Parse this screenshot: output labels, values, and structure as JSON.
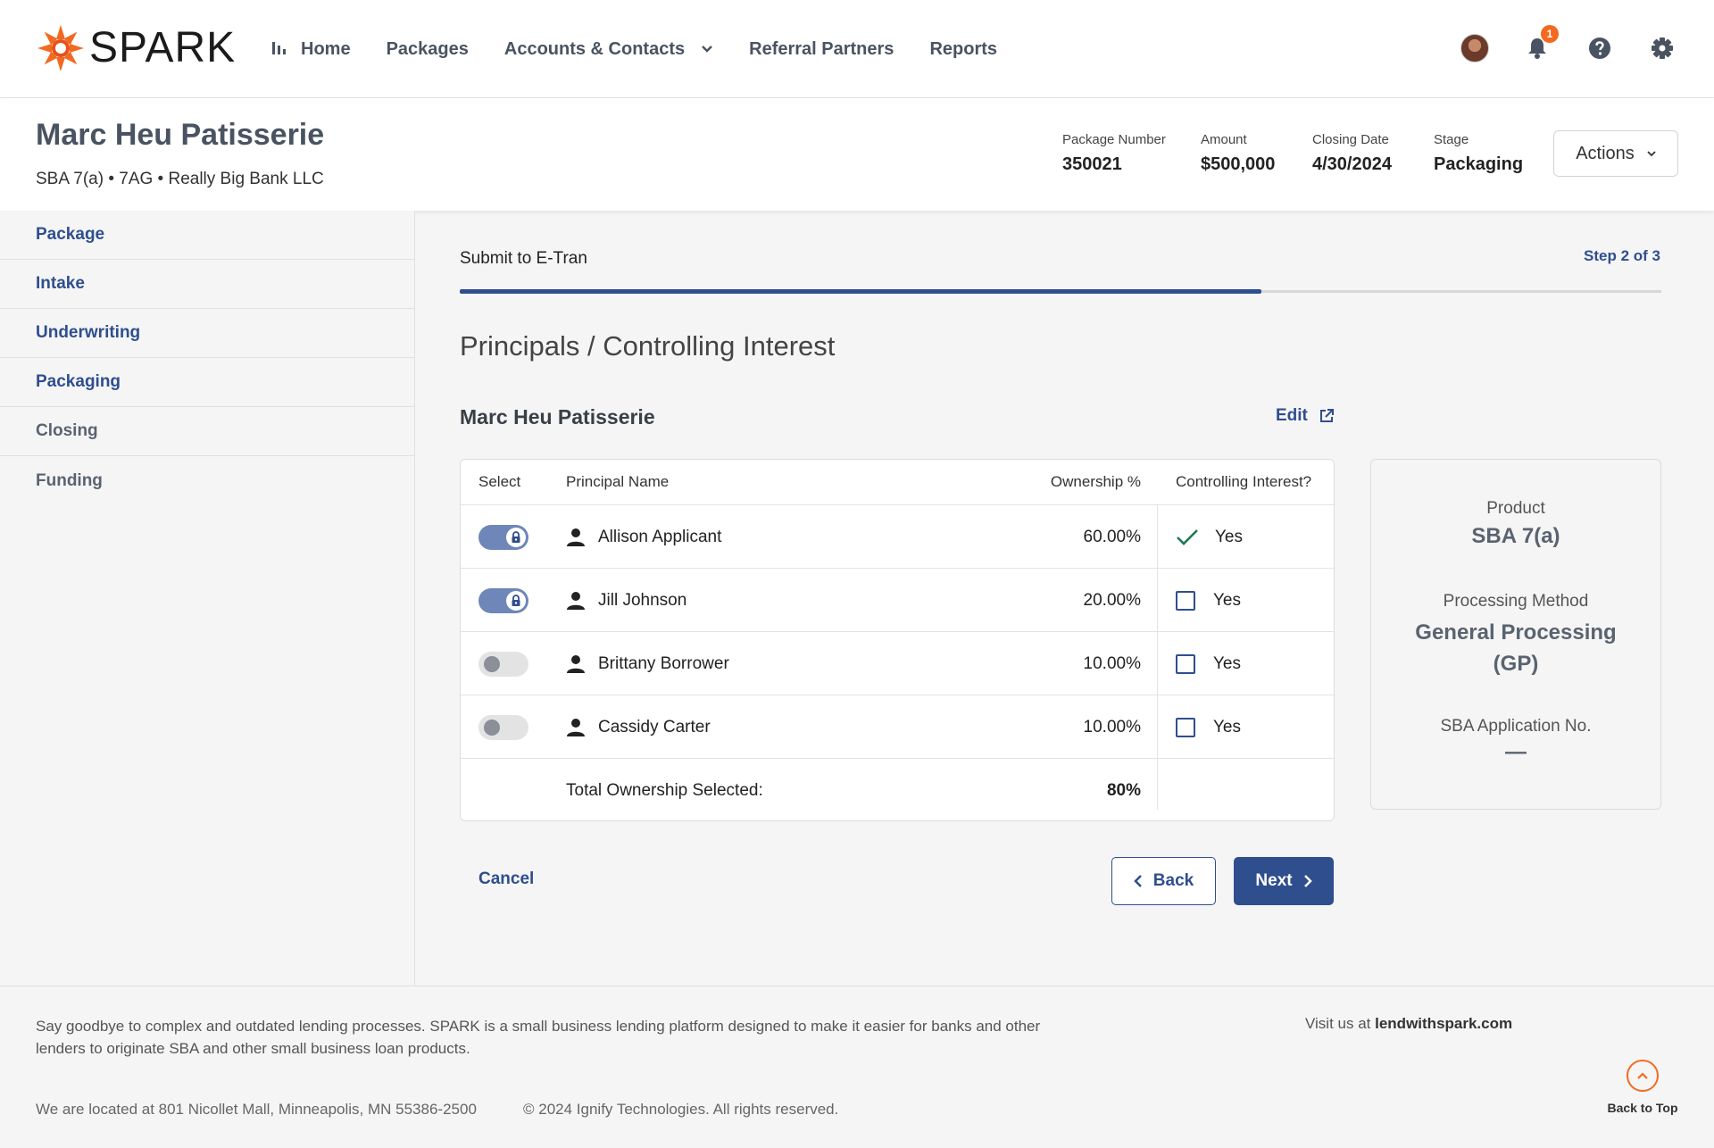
{
  "brand": {
    "name": "SPARK",
    "accent": "#f26a21",
    "primary": "#2f4e8e"
  },
  "nav": {
    "items": [
      {
        "label": "Home",
        "icon": "bar-chart-icon"
      },
      {
        "label": "Packages"
      },
      {
        "label": "Accounts & Contacts",
        "icon": "chevron-down-icon"
      },
      {
        "label": "Referral Partners"
      },
      {
        "label": "Reports"
      }
    ],
    "notifications_count": "1",
    "icons": [
      "avatar",
      "bell-icon",
      "help-icon",
      "gear-icon"
    ]
  },
  "header": {
    "title": "Marc Heu Patisserie",
    "subtitle": "SBA 7(a) • 7AG • Really Big Bank LLC",
    "meta": [
      {
        "label": "Package Number",
        "value": "350021"
      },
      {
        "label": "Amount",
        "value": "$500,000"
      },
      {
        "label": "Closing Date",
        "value": "4/30/2024"
      },
      {
        "label": "Stage",
        "value": "Packaging"
      }
    ],
    "actions_label": "Actions"
  },
  "sidebar": {
    "items": [
      {
        "label": "Package",
        "state": "active"
      },
      {
        "label": "Intake",
        "state": "active"
      },
      {
        "label": "Underwriting",
        "state": "active"
      },
      {
        "label": "Packaging",
        "state": "active"
      },
      {
        "label": "Closing",
        "state": "inactive"
      },
      {
        "label": "Funding",
        "state": "inactive"
      }
    ]
  },
  "main": {
    "step_label": "Submit to E-Tran",
    "step_count": "Step 2 of 3",
    "progress_fraction": 0.667,
    "section_title": "Principals / Controlling Interest",
    "entity_name": "Marc Heu Patisserie",
    "edit_label": "Edit",
    "table": {
      "headers": [
        "Select",
        "Principal Name",
        "Ownership %",
        "Controlling Interest?"
      ],
      "rows": [
        {
          "selected": true,
          "locked": true,
          "name": "Allison Applicant",
          "ownership": "60.00%",
          "controlling": true,
          "controlling_label": "Yes"
        },
        {
          "selected": true,
          "locked": true,
          "name": "Jill Johnson",
          "ownership": "20.00%",
          "controlling": false,
          "controlling_label": "Yes"
        },
        {
          "selected": false,
          "locked": false,
          "name": "Brittany Borrower",
          "ownership": "10.00%",
          "controlling": false,
          "controlling_label": "Yes"
        },
        {
          "selected": false,
          "locked": false,
          "name": "Cassidy Carter",
          "ownership": "10.00%",
          "controlling": false,
          "controlling_label": "Yes"
        }
      ],
      "total_label": "Total Ownership Selected:",
      "total_value": "80%"
    },
    "cancel_label": "Cancel",
    "back_label": "Back",
    "next_label": "Next"
  },
  "info_card": {
    "product_label": "Product",
    "product_value": "SBA 7(a)",
    "method_label": "Processing Method",
    "method_value_line1": "General Processing",
    "method_value_line2": "(GP)",
    "appno_label": "SBA Application No.",
    "appno_value": "—"
  },
  "footer": {
    "description": "Say goodbye to complex and outdated lending processes. SPARK is a small business lending platform designed to make it easier for banks and other lenders to originate SBA and other small business loan products.",
    "visit_prefix": "Visit us at ",
    "visit_link": "lendwithspark.com",
    "address": "We are located at 801 Nicollet Mall, Minneapolis, MN 55386-2500",
    "copyright": "© 2024 Ignify Technologies. All rights reserved.",
    "back_to_top": "Back to Top"
  }
}
